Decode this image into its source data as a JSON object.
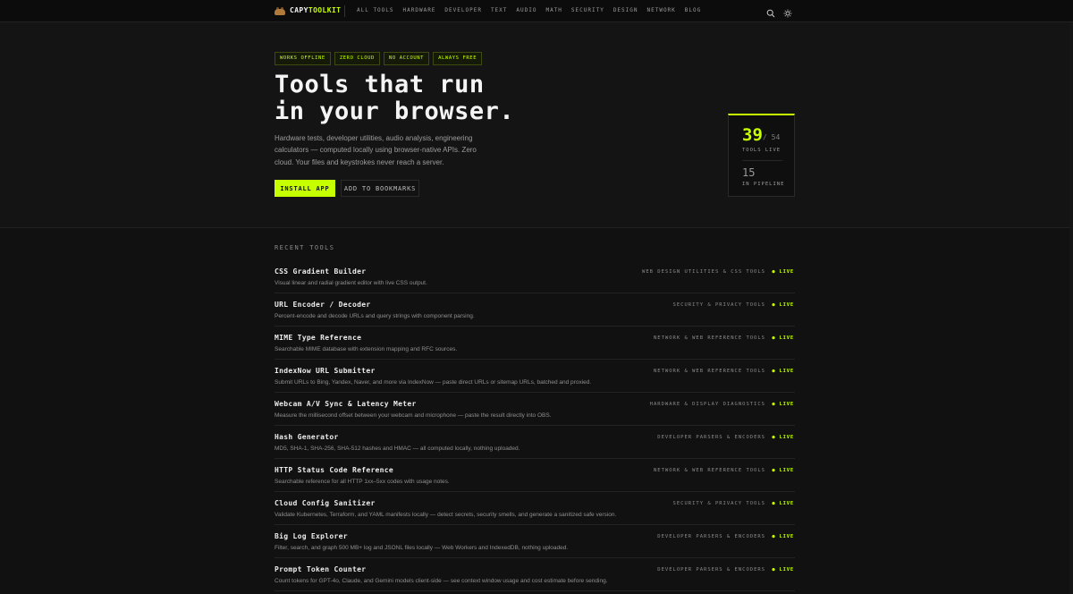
{
  "header": {
    "brand_part1": "CAPY",
    "brand_part2": "TOOLKIT",
    "nav": [
      "ALL TOOLS",
      "HARDWARE",
      "DEVELOPER",
      "TEXT",
      "AUDIO",
      "MATH",
      "SECURITY",
      "DESIGN",
      "NETWORK",
      "BLOG"
    ],
    "icons": [
      "search-icon",
      "sun-icon"
    ]
  },
  "hero": {
    "badges": [
      "WORKS OFFLINE",
      "ZERO CLOUD",
      "NO ACCOUNT",
      "ALWAYS FREE"
    ],
    "title_line1": "Tools that run",
    "title_line2": "in your browser.",
    "description": "Hardware tests, developer utilities, audio analysis, engineering calculators — computed locally using browser-native APIs. Zero cloud. Your files and keystrokes never reach a server.",
    "install_label": "INSTALL APP",
    "bookmark_label": "ADD TO BOOKMARKS",
    "stats": {
      "live_count": "39",
      "total": "/ 54",
      "live_label": "TOOLS LIVE",
      "pipeline_count": "15",
      "pipeline_label": "IN PIPELINE"
    }
  },
  "recent": {
    "label": "RECENT TOOLS",
    "tools": [
      {
        "name": "CSS Gradient Builder",
        "desc": "Visual linear and radial gradient editor with live CSS output.",
        "category": "WEB DESIGN UTILITIES & CSS TOOLS",
        "status": "● LIVE"
      },
      {
        "name": "URL Encoder / Decoder",
        "desc": "Percent-encode and decode URLs and query strings with component parsing.",
        "category": "SECURITY & PRIVACY TOOLS",
        "status": "● LIVE"
      },
      {
        "name": "MIME Type Reference",
        "desc": "Searchable MIME database with extension mapping and RFC sources.",
        "category": "NETWORK & WEB REFERENCE TOOLS",
        "status": "● LIVE"
      },
      {
        "name": "IndexNow URL Submitter",
        "desc": "Submit URLs to Bing, Yandex, Naver, and more via IndexNow — paste direct URLs or sitemap URLs, batched and proxied.",
        "category": "NETWORK & WEB REFERENCE TOOLS",
        "status": "● LIVE"
      },
      {
        "name": "Webcam A/V Sync & Latency Meter",
        "desc": "Measure the millisecond offset between your webcam and microphone — paste the result directly into OBS.",
        "category": "HARDWARE & DISPLAY DIAGNOSTICS",
        "status": "● LIVE"
      },
      {
        "name": "Hash Generator",
        "desc": "MD5, SHA-1, SHA-256, SHA-512 hashes and HMAC — all computed locally, nothing uploaded.",
        "category": "DEVELOPER PARSERS & ENCODERS",
        "status": "● LIVE"
      },
      {
        "name": "HTTP Status Code Reference",
        "desc": "Searchable reference for all HTTP 1xx–5xx codes with usage notes.",
        "category": "NETWORK & WEB REFERENCE TOOLS",
        "status": "● LIVE"
      },
      {
        "name": "Cloud Config Sanitizer",
        "desc": "Validate Kubernetes, Terraform, and YAML manifests locally — detect secrets, security smells, and generate a sanitized safe version.",
        "category": "SECURITY & PRIVACY TOOLS",
        "status": "● LIVE"
      },
      {
        "name": "Big Log Explorer",
        "desc": "Filter, search, and graph 500 MB+ log and JSONL files locally — Web Workers and IndexedDB, nothing uploaded.",
        "category": "DEVELOPER PARSERS & ENCODERS",
        "status": "● LIVE"
      },
      {
        "name": "Prompt Token Counter",
        "desc": "Count tokens for GPT-4o, Claude, and Gemini models client-side — see context window usage and cost estimate before sending.",
        "category": "DEVELOPER PARSERS & ENCODERS",
        "status": "● LIVE"
      }
    ]
  },
  "colors": {
    "accent": "#c6ff00",
    "background": "#111111",
    "text": "#ededed"
  }
}
